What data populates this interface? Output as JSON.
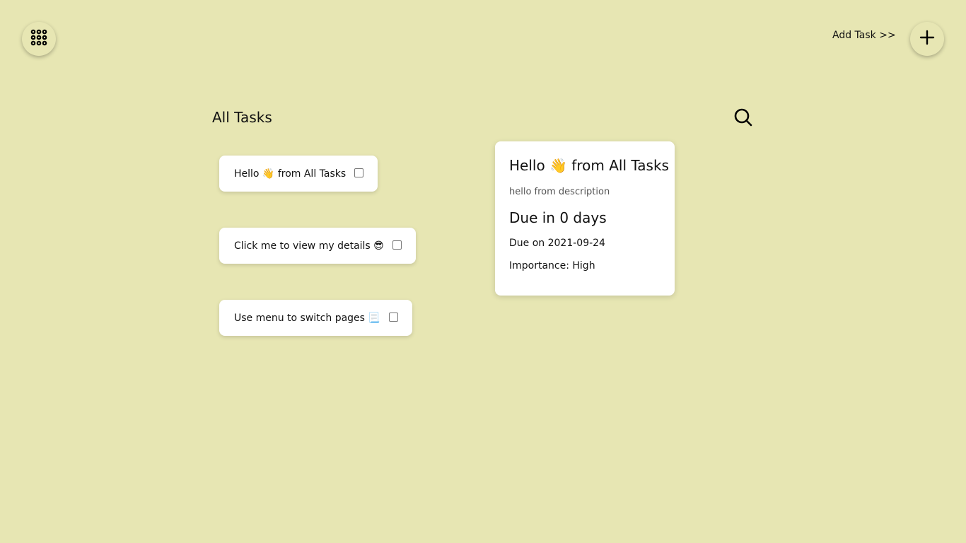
{
  "header": {
    "menu_icon": "grid-icon",
    "add_task_label": "Add Task >>",
    "add_icon": "plus-icon"
  },
  "main": {
    "title": "All Tasks",
    "search_icon": "search-icon",
    "tasks": [
      {
        "label": "Hello 👋 from All Tasks",
        "checked": false
      },
      {
        "label": "Click me to view my details 😎",
        "checked": false
      },
      {
        "label": "Use menu to switch pages 📃",
        "checked": false
      }
    ]
  },
  "detail": {
    "title": "Hello 👋 from All Tasks",
    "description": "hello from description",
    "due_in": "Due in 0 days",
    "due_on": "Due on 2021-09-24",
    "importance": "Importance: High"
  },
  "colors": {
    "background": "#e7e6b3",
    "card": "#ffffff",
    "text": "#111111"
  }
}
